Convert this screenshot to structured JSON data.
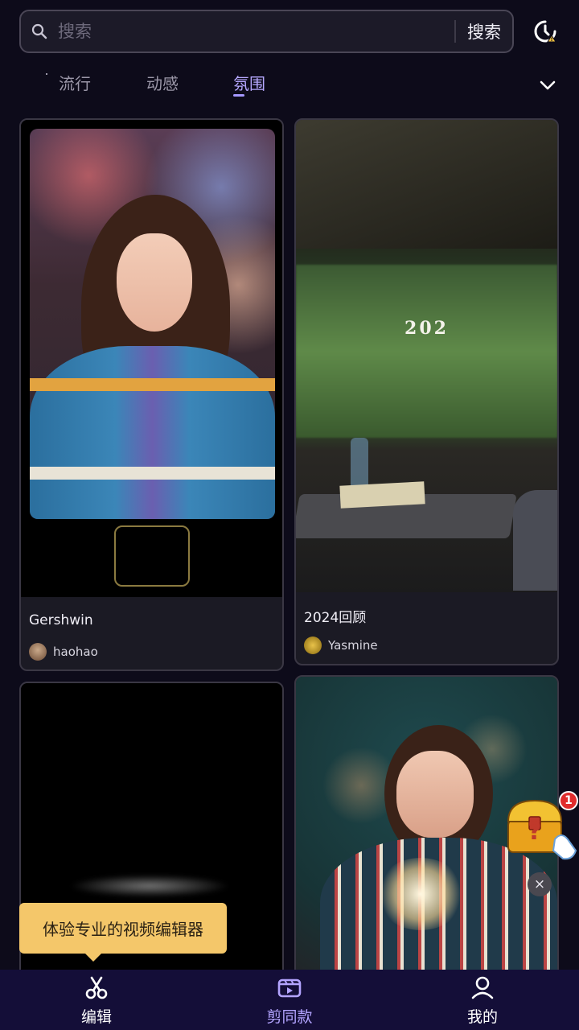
{
  "search": {
    "placeholder": "搜索",
    "button_label": "搜索"
  },
  "tabs": [
    {
      "label": "流行",
      "active": false
    },
    {
      "label": "动感",
      "active": false
    },
    {
      "label": "氛围",
      "active": true
    }
  ],
  "cards": [
    {
      "title": "Gershwin",
      "author": "haohao"
    },
    {
      "title": "2024回顾",
      "author": "Yasmine",
      "overlay_text": "202"
    },
    {
      "title": "",
      "author": ""
    },
    {
      "title": "",
      "author": ""
    }
  ],
  "floating_chest": {
    "badge_count": "1",
    "close_label": "×"
  },
  "tooltip": {
    "text": "体验专业的视频编辑器"
  },
  "bottom_nav": [
    {
      "label": "编辑",
      "icon": "scissors-icon",
      "active": false
    },
    {
      "label": "剪同款",
      "icon": "template-icon",
      "active": true
    },
    {
      "label": "我的",
      "icon": "profile-icon",
      "active": false
    }
  ],
  "colors": {
    "accent": "#b3a4ff",
    "background": "#0d0b1a",
    "nav_background": "#140e38",
    "tooltip": "#f4c76a"
  }
}
